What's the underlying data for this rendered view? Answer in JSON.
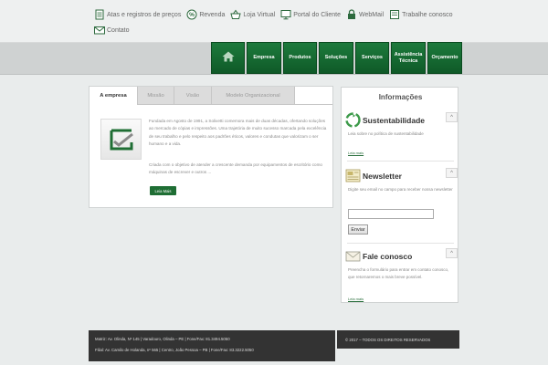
{
  "toplinks": [
    {
      "label": "Atas e registros de preços",
      "icon": "notepad-icon"
    },
    {
      "label": "Revenda",
      "icon": "percent-tag-icon"
    },
    {
      "label": "Loja Virtual",
      "icon": "basket-icon"
    },
    {
      "label": "Portal do Cliente",
      "icon": "monitor-icon"
    },
    {
      "label": "WebMail",
      "icon": "lock-icon"
    },
    {
      "label": "Trabalhe conosco",
      "icon": "document-icon"
    },
    {
      "label": "Contato",
      "icon": "envelope-icon"
    }
  ],
  "nav": {
    "home_icon": "home-icon",
    "items": [
      "Empresa",
      "Produtos",
      "Soluções",
      "Serviços",
      "Assistência Técnica",
      "Orçamento"
    ]
  },
  "tabs": [
    "A empresa",
    "Missão",
    "Visão",
    "Modelo Organizacional"
  ],
  "about": {
    "paragraph1": "Fundada em Agosto de 1991, a Solivetti comemora mais de duas décadas, ofertando soluções ao mercado de cópias e impressões. Uma trajetória de muito sucesso marcada pela excelência de seu trabalho e pelo respeito aos padrões éticos, valores e condutas que valorizam o ser humano e a vida.",
    "paragraph2": "Criada com o objetivo de atender a crescente demanda por equipamentos de escritório como máquinas de escrever e outros ...",
    "button": "Leia Mais"
  },
  "sidebar": {
    "title": "Informações",
    "sustentabilidade": {
      "title": "Sustentabilidade",
      "text": "Leia sobre no política de sustentabilidade",
      "link": "Leia mais",
      "toggle": "^"
    },
    "newsletter": {
      "title": "Newsletter",
      "text": "Digite seu email no campo para receber nossa newsletter",
      "input_value": "",
      "button": "Enviar",
      "toggle": "^"
    },
    "contato": {
      "title": "Fale conosco",
      "text": "Preencha o formulário para entrar em contato conosco, que retornaremos o mais breve possível.",
      "link": "Leia mais",
      "toggle": "^"
    }
  },
  "footer": {
    "line1": "Matriz: Av. Olinda, Nº 145 | Varadouro, Olinda – PE | Fone/Fax: 81.3494.5050",
    "line2": "Filial: Av. Camilo de Holanda, nº 565 | Centro, João Pessoa – PB | Fone/Fax: 83.3222.5050",
    "copyright": "© 2017 – TODOS OS DIREITOS RESERVADOS"
  },
  "colors": {
    "accent_green": "#1d7a3c",
    "footer_bg": "#333333",
    "page_bg": "#e9ecec"
  }
}
